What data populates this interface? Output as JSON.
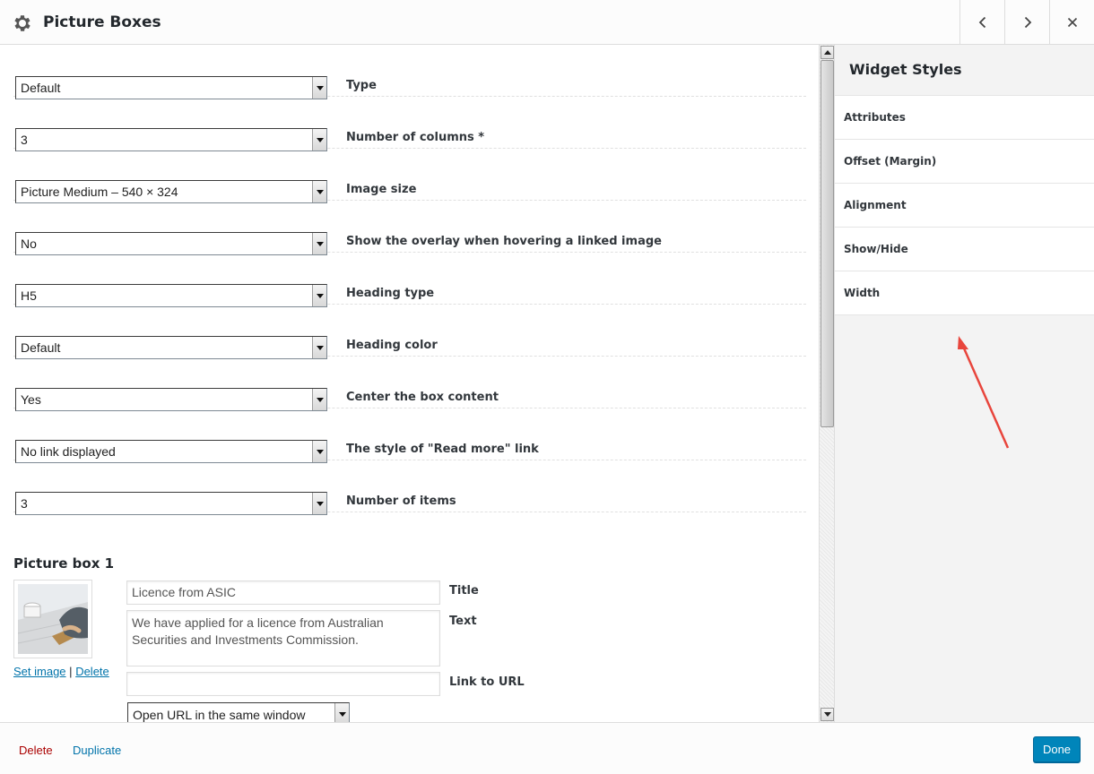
{
  "header": {
    "title": "Picture Boxes",
    "icons": {
      "settings": "gear-icon",
      "prev": "chevron-left-icon",
      "next": "chevron-right-icon",
      "close": "close-icon"
    }
  },
  "fields": [
    {
      "value": "Default",
      "label": "Type"
    },
    {
      "value": "3",
      "label": "Number of columns *"
    },
    {
      "value": "Picture Medium – 540 × 324",
      "label": "Image size"
    },
    {
      "value": "No",
      "label": "Show the overlay when hovering a linked image"
    },
    {
      "value": "H5",
      "label": "Heading type"
    },
    {
      "value": "Default",
      "label": "Heading color"
    },
    {
      "value": "Yes",
      "label": "Center the box content"
    },
    {
      "value": "No link displayed",
      "label": "The style of \"Read more\" link"
    },
    {
      "value": "3",
      "label": "Number of items"
    }
  ],
  "picture_box": {
    "title": "Picture box 1",
    "set_image": "Set image",
    "separator": "|",
    "delete_image": "Delete",
    "title_value": "Licence from ASIC",
    "title_label": "Title",
    "text_value": "We have applied for a licence from Australian Securities and Investments Commission.",
    "text_label": "Text",
    "link_value": "",
    "link_label": "Link to URL",
    "target_value": "Open URL in the same window"
  },
  "sidebar": {
    "title": "Widget Styles",
    "items": [
      "Attributes",
      "Offset (Margin)",
      "Alignment",
      "Show/Hide",
      "Width"
    ]
  },
  "footer": {
    "delete": "Delete",
    "duplicate": "Duplicate",
    "done": "Done"
  },
  "colors": {
    "accent": "#0085ba",
    "delete": "#aa0000",
    "link": "#0073aa",
    "annotation_arrow": "#e8453c"
  }
}
